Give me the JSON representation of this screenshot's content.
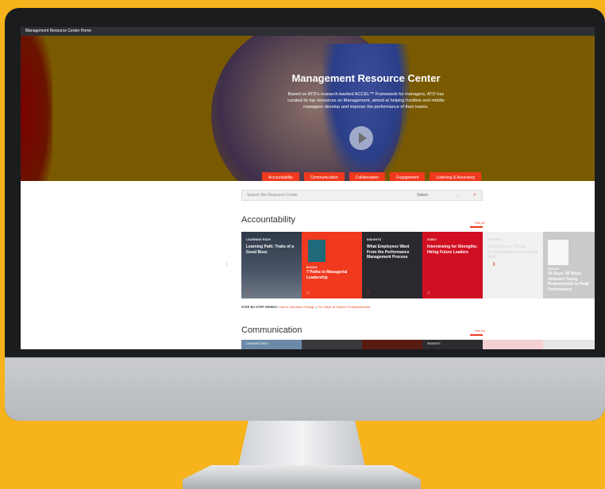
{
  "topbar": {
    "label": "Management Resource Center Home"
  },
  "hero": {
    "title": "Management Resource Center",
    "description": "Based on ATD's research-backed ACCEL™ Framework for managers, ATD has curated its top resources on Management, aimed at helping frontline and middle managers develop and improve the performance of their teams.",
    "buttons": [
      "Accountability",
      "Communication",
      "Collaboration",
      "Engagement",
      "Listening & Assessing"
    ]
  },
  "search": {
    "placeholder": "Search this Resource Center",
    "select": "Select"
  },
  "sections": {
    "accountability": {
      "title": "Accountability",
      "see_all": "See All",
      "cards": [
        {
          "tag": "LEARNING PATH",
          "title": "Learning Path: Traits of a Good Boss"
        },
        {
          "tag": "BOOKS",
          "title": "7 Paths to Managerial Leadership"
        },
        {
          "tag": "INSIGHTS",
          "title": "What Employees Want From the Performance Management Process"
        },
        {
          "tag": "VIDEO",
          "title": "Interviewing for Strengths: Hiring Future Leaders"
        },
        {
          "tag": "INSIGHTS",
          "title": "Three Keys to Driving Accountability in Your Virtual Work"
        },
        {
          "tag": "BOOKS",
          "title": "90 Days: 90 Ways: Onboard Young Professionals to Peak Performance"
        }
      ]
    },
    "communication": {
      "title": "Communication",
      "see_all": "See All",
      "cards": [
        {
          "tag": "LEARNING PATH"
        },
        {
          "tag": ""
        },
        {
          "tag": ""
        },
        {
          "tag": "INSIGHTS"
        }
      ]
    }
  },
  "stepbar": {
    "label": "STEP-BY-STEP SERIES:",
    "link1": "How to Introduce Change",
    "separator": "|",
    "link2": "The Value of Culture Fit Assessments"
  },
  "colors": {
    "accent": "#f0391e",
    "background": "#f6b31b",
    "hero": "#7a5a00"
  }
}
